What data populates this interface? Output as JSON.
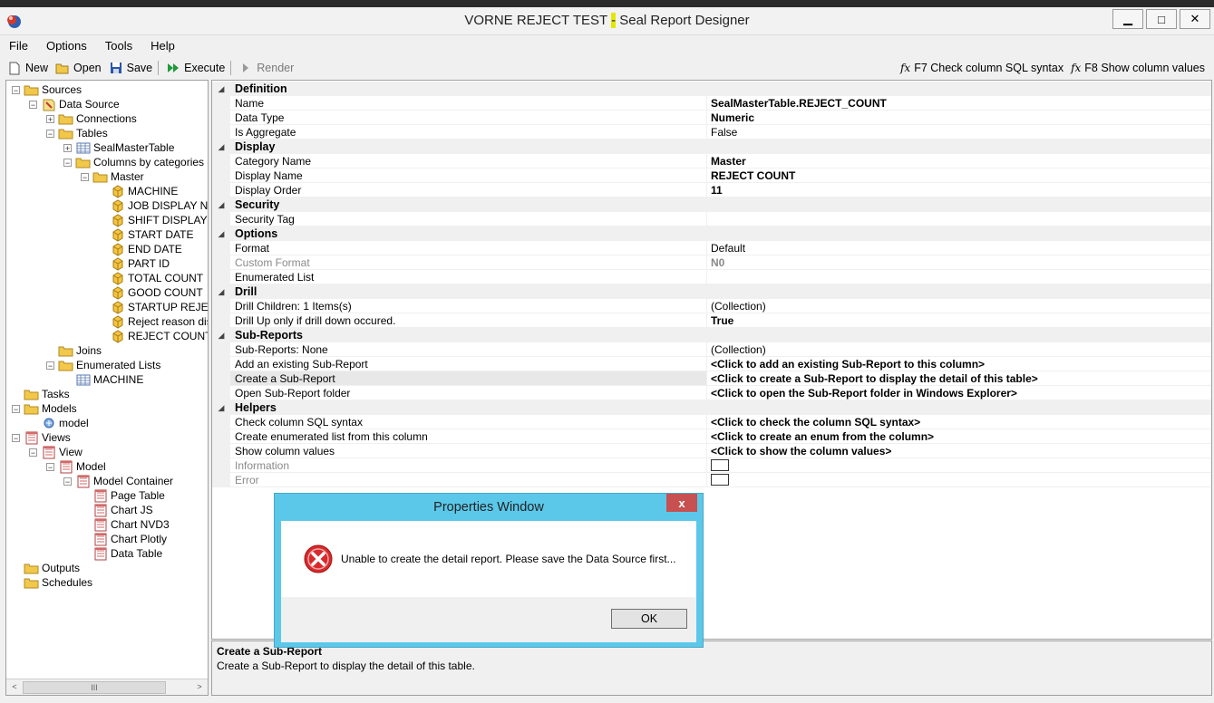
{
  "window": {
    "title_part1": "VORNE REJECT TEST",
    "title_dash": "-",
    "title_part2": " Seal Report Designer",
    "minimize": "▁",
    "maximize": "□",
    "close": "✕"
  },
  "menu": [
    "File",
    "Options",
    "Tools",
    "Help"
  ],
  "toolbar": {
    "new": "New",
    "open": "Open",
    "save": "Save",
    "execute": "Execute",
    "render": "Render",
    "check_sql": "F7 Check column SQL syntax",
    "show_values": "F8 Show column values",
    "fx": "fx"
  },
  "tree": [
    {
      "label": "Sources",
      "level": 0,
      "exp": "−",
      "icon": "folder"
    },
    {
      "label": "Data Source",
      "level": 1,
      "exp": "−",
      "icon": "datasource"
    },
    {
      "label": "Connections",
      "level": 2,
      "exp": "+",
      "icon": "folder"
    },
    {
      "label": "Tables",
      "level": 2,
      "exp": "−",
      "icon": "folder"
    },
    {
      "label": "SealMasterTable",
      "level": 3,
      "exp": "+",
      "icon": "table"
    },
    {
      "label": "Columns by categories",
      "level": 3,
      "exp": "−",
      "icon": "folder"
    },
    {
      "label": "Master",
      "level": 4,
      "exp": "−",
      "icon": "folder"
    },
    {
      "label": "MACHINE",
      "level": 5,
      "exp": "",
      "icon": "column"
    },
    {
      "label": "JOB DISPLAY NA",
      "level": 5,
      "exp": "",
      "icon": "column"
    },
    {
      "label": "SHIFT DISPLAY",
      "level": 5,
      "exp": "",
      "icon": "column"
    },
    {
      "label": "START DATE",
      "level": 5,
      "exp": "",
      "icon": "column"
    },
    {
      "label": "END DATE",
      "level": 5,
      "exp": "",
      "icon": "column"
    },
    {
      "label": "PART ID",
      "level": 5,
      "exp": "",
      "icon": "column"
    },
    {
      "label": "TOTAL COUNT",
      "level": 5,
      "exp": "",
      "icon": "column"
    },
    {
      "label": "GOOD COUNT",
      "level": 5,
      "exp": "",
      "icon": "column"
    },
    {
      "label": "STARTUP REJE",
      "level": 5,
      "exp": "",
      "icon": "column"
    },
    {
      "label": "Reject reason dis",
      "level": 5,
      "exp": "",
      "icon": "column"
    },
    {
      "label": "REJECT COUNT",
      "level": 5,
      "exp": "",
      "icon": "column"
    },
    {
      "label": "Joins",
      "level": 2,
      "exp": "",
      "icon": "folder"
    },
    {
      "label": "Enumerated Lists",
      "level": 2,
      "exp": "−",
      "icon": "folder"
    },
    {
      "label": "MACHINE",
      "level": 3,
      "exp": "",
      "icon": "table"
    },
    {
      "label": "Tasks",
      "level": 0,
      "exp": "",
      "icon": "folder"
    },
    {
      "label": "Models",
      "level": 0,
      "exp": "−",
      "icon": "folder"
    },
    {
      "label": "model",
      "level": 1,
      "exp": "",
      "icon": "model"
    },
    {
      "label": "Views",
      "level": 0,
      "exp": "−",
      "icon": "view"
    },
    {
      "label": "View",
      "level": 1,
      "exp": "−",
      "icon": "view"
    },
    {
      "label": "Model",
      "level": 2,
      "exp": "−",
      "icon": "view"
    },
    {
      "label": "Model Container",
      "level": 3,
      "exp": "−",
      "icon": "view"
    },
    {
      "label": "Page Table",
      "level": 4,
      "exp": "",
      "icon": "view"
    },
    {
      "label": "Chart JS",
      "level": 4,
      "exp": "",
      "icon": "view"
    },
    {
      "label": "Chart NVD3",
      "level": 4,
      "exp": "",
      "icon": "view"
    },
    {
      "label": "Chart Plotly",
      "level": 4,
      "exp": "",
      "icon": "view"
    },
    {
      "label": "Data Table",
      "level": 4,
      "exp": "",
      "icon": "view"
    },
    {
      "label": "Outputs",
      "level": 0,
      "exp": "",
      "icon": "folder"
    },
    {
      "label": "Schedules",
      "level": 0,
      "exp": "",
      "icon": "folder"
    }
  ],
  "tree_scroll": {
    "thumb": "III",
    "left": "<",
    "right": ">"
  },
  "properties": [
    {
      "cat": true,
      "name": "Definition"
    },
    {
      "name": "Name",
      "value": "SealMasterTable.REJECT_COUNT",
      "bold": true
    },
    {
      "name": "Data Type",
      "value": "Numeric",
      "bold": true
    },
    {
      "name": "Is Aggregate",
      "value": "False"
    },
    {
      "cat": true,
      "name": "Display"
    },
    {
      "name": "Category Name",
      "value": "Master",
      "bold": true
    },
    {
      "name": "Display Name",
      "value": "REJECT COUNT",
      "bold": true
    },
    {
      "name": "Display Order",
      "value": "11",
      "bold": true
    },
    {
      "cat": true,
      "name": "Security"
    },
    {
      "name": "Security Tag",
      "value": ""
    },
    {
      "cat": true,
      "name": "Options"
    },
    {
      "name": "Format",
      "value": "Default"
    },
    {
      "name": "Custom Format",
      "value": "N0",
      "bold": true,
      "grey": true
    },
    {
      "name": "Enumerated List",
      "value": ""
    },
    {
      "cat": true,
      "name": "Drill"
    },
    {
      "name": "Drill Children: 1 Items(s)",
      "value": "(Collection)"
    },
    {
      "name": "Drill Up only if drill down occured.",
      "value": "True",
      "bold": true
    },
    {
      "cat": true,
      "name": "Sub-Reports"
    },
    {
      "name": "Sub-Reports: None",
      "value": "(Collection)"
    },
    {
      "name": "Add an existing Sub-Report",
      "value": "<Click to add an existing Sub-Report to this column>",
      "bold": true
    },
    {
      "name": "Create a Sub-Report",
      "value": "<Click to create a Sub-Report to display the detail of this table>",
      "bold": true,
      "selected": true
    },
    {
      "name": "Open Sub-Report folder",
      "value": "<Click to open the Sub-Report folder in Windows Explorer>",
      "bold": true
    },
    {
      "cat": true,
      "name": "Helpers"
    },
    {
      "name": "Check column SQL syntax",
      "value": "<Click to check the column SQL syntax>",
      "bold": true
    },
    {
      "name": "Create enumerated list from this column",
      "value": "<Click to create an enum from the column>",
      "bold": true
    },
    {
      "name": "Show column values",
      "value": "<Click to show the column values>",
      "bold": true
    },
    {
      "name": "Information",
      "value": "",
      "grey": true,
      "swatch": true
    },
    {
      "name": "Error",
      "value": "",
      "grey": true,
      "swatch": true
    }
  ],
  "collapse_glyph": "◢",
  "description": {
    "title": "Create a Sub-Report",
    "text": "Create a Sub-Report to display the detail of this table."
  },
  "dialog": {
    "title": "Properties Window",
    "close": "x",
    "message": "Unable to create the detail report. Please save the Data Source first...",
    "ok": "OK"
  },
  "colors": {
    "dialog_frame": "#5bc8ea",
    "dialog_close": "#c75050",
    "error_red": "#d9292b",
    "folder": "#f2c84b"
  }
}
